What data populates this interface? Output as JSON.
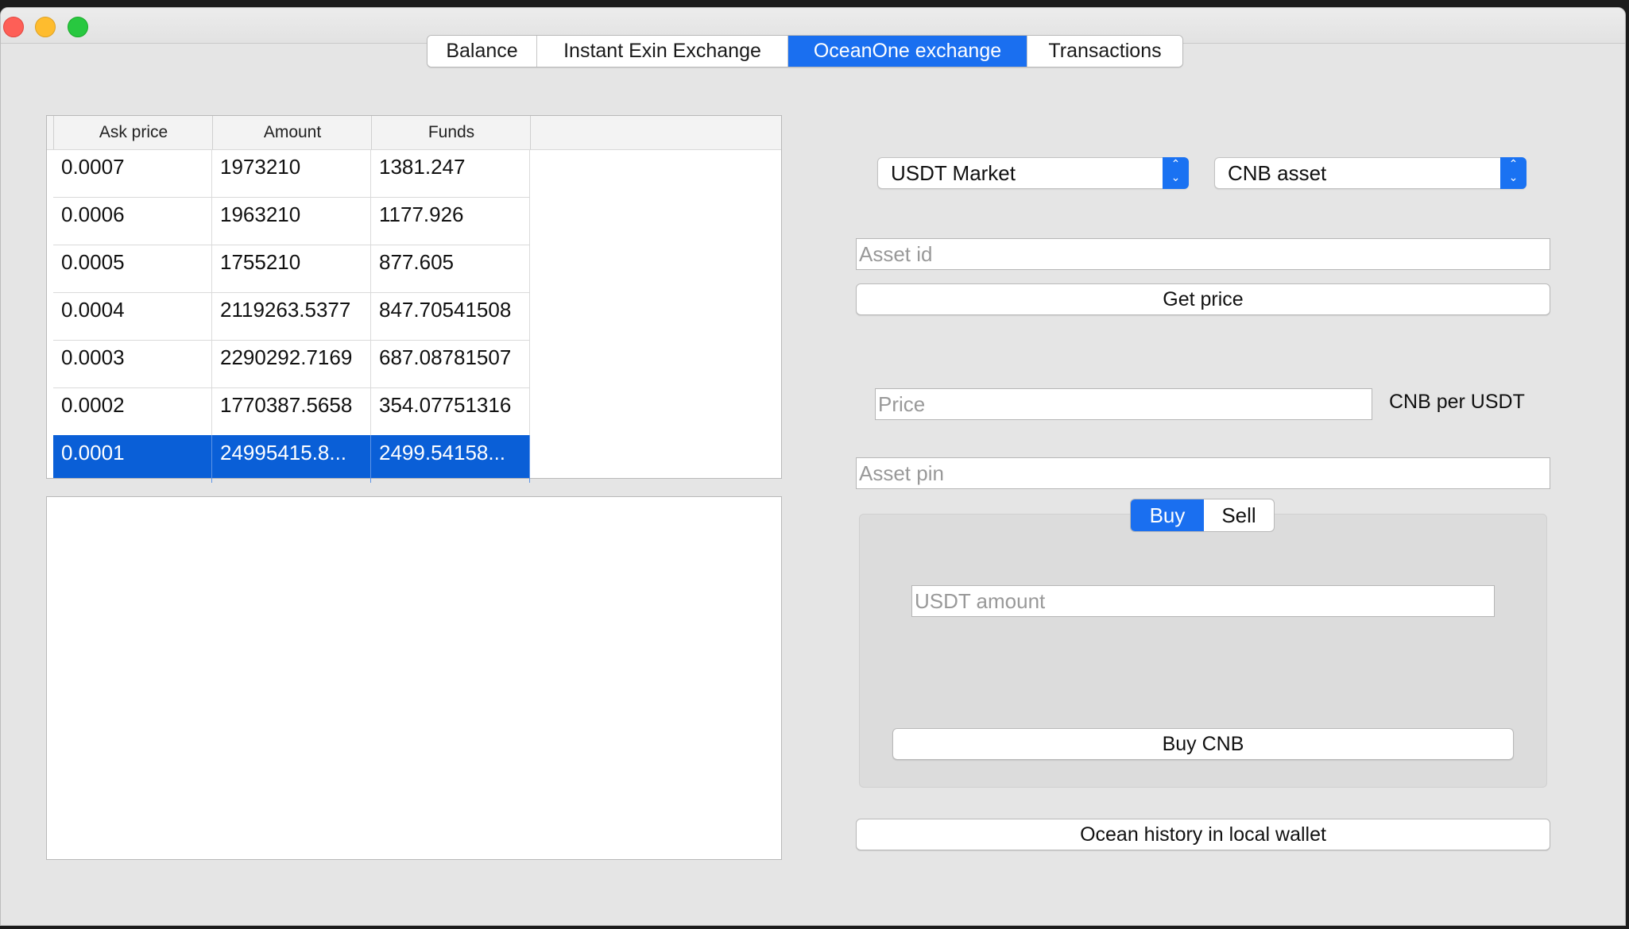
{
  "tabs": [
    {
      "label": "Balance",
      "active": false
    },
    {
      "label": "Instant Exin Exchange",
      "active": false
    },
    {
      "label": "OceanOne exchange",
      "active": true
    },
    {
      "label": "Transactions",
      "active": false
    }
  ],
  "order_table": {
    "headers": [
      "Ask price",
      "Amount",
      "Funds"
    ],
    "rows": [
      [
        "0.0007",
        "1973210",
        "1381.247"
      ],
      [
        "0.0006",
        "1963210",
        "1177.926"
      ],
      [
        "0.0005",
        "1755210",
        "877.605"
      ],
      [
        "0.0004",
        "2119263.5377",
        "847.70541508"
      ],
      [
        "0.0003",
        "2290292.7169",
        "687.08781507"
      ],
      [
        "0.0002",
        "1770387.5658",
        "354.07751316"
      ],
      [
        "0.0001",
        "24995415.8...",
        "2499.54158..."
      ]
    ],
    "selected_row": 6
  },
  "market_select": {
    "value": "USDT Market"
  },
  "asset_select": {
    "value": "CNB asset"
  },
  "asset_id_field": {
    "placeholder": "Asset id",
    "value": ""
  },
  "get_price_button": {
    "label": "Get price"
  },
  "price_field": {
    "placeholder": "Price",
    "value": ""
  },
  "price_unit": "CNB per USDT",
  "asset_pin_field": {
    "placeholder": "Asset pin",
    "value": ""
  },
  "trade_mode": {
    "options": [
      "Buy",
      "Sell"
    ],
    "selected": "Buy"
  },
  "amount_field": {
    "placeholder": "USDT amount",
    "value": ""
  },
  "submit_button": {
    "label": "Buy CNB"
  },
  "history_button": {
    "label": "Ocean history in local wallet"
  },
  "colors": {
    "accent": "#1a6ff0",
    "selection": "#0a5fd7"
  }
}
